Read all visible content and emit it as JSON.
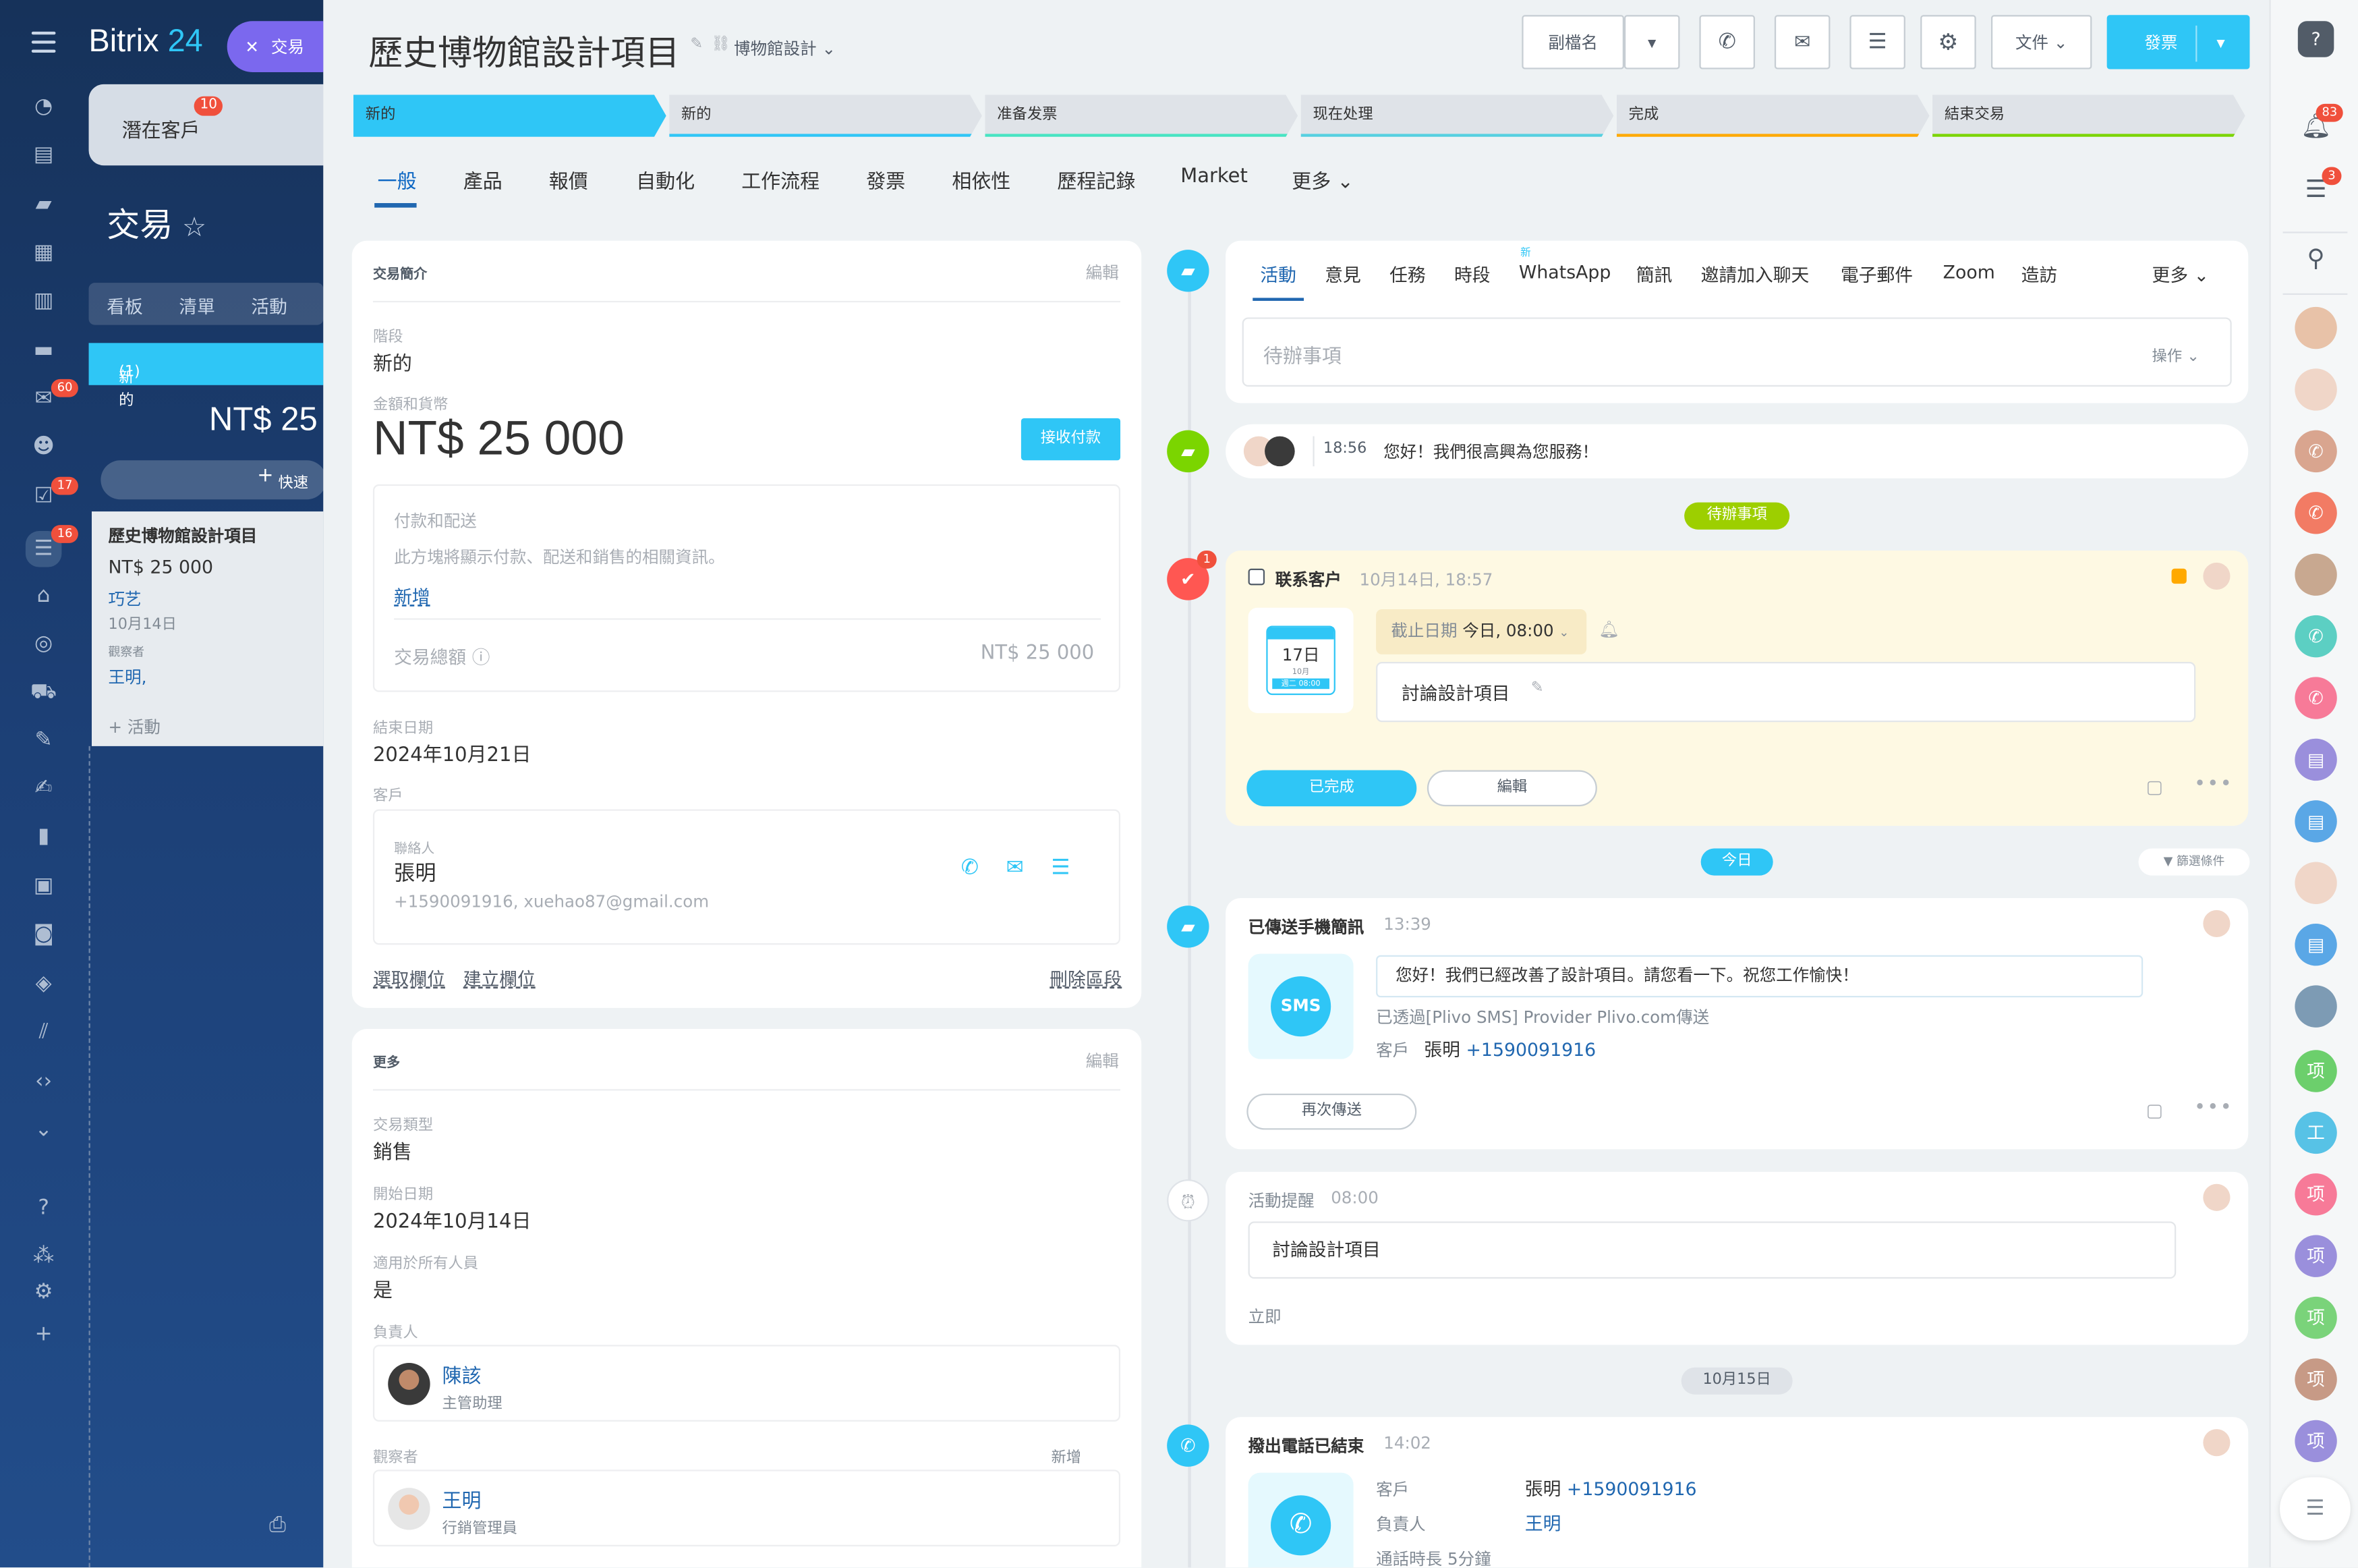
{
  "left_sidebar": {
    "brand_main": "Bitrix",
    "brand_num": "24",
    "chip_label": "交易",
    "badges": {
      "messages": "60",
      "tasks": "17",
      "crm": "16"
    }
  },
  "kanban": {
    "lead_label": "潛在客戶",
    "lead_badge": "10",
    "page_title": "交易",
    "tabs": [
      "看板",
      "清單",
      "活動"
    ],
    "column_name": "新的",
    "column_count": "(1)",
    "column_sum": "NT$ 25",
    "quick_label": "快速",
    "card": {
      "title": "歷史博物館設計項目",
      "value": "NT$ 25 000",
      "company": "巧艺",
      "date": "10月14日",
      "observer_label": "觀察者",
      "observer": "王明,",
      "activity": "+ 活動"
    }
  },
  "header": {
    "title": "歷史博物館設計項目",
    "category": "博物館設計",
    "rename_button": "副檔名",
    "document_button": "文件",
    "invoice_button": "發票"
  },
  "stages": [
    {
      "label": "新的",
      "color": "#2fc6f6"
    },
    {
      "label": "新的",
      "color": "#2fc6f6"
    },
    {
      "label": "准备发票",
      "color": "#47e4c2"
    },
    {
      "label": "现在处理",
      "color": "#55d0e0"
    },
    {
      "label": "完成",
      "color": "#ffa900"
    },
    {
      "label": "結束交易",
      "color": "#7bd500"
    }
  ],
  "tabs": [
    "一般",
    "產品",
    "報價",
    "自動化",
    "工作流程",
    "發票",
    "相依性",
    "歷程記錄",
    "Market",
    "更多"
  ],
  "summary": {
    "section_title": "交易簡介",
    "edit": "編輯",
    "stage_label": "階段",
    "stage_value": "新的",
    "amount_label": "金額和貨幣",
    "amount_value": "NT$ 25 000",
    "receive_payment": "接收付款",
    "payment_title": "付款和配送",
    "payment_desc": "此方塊將顯示付款、配送和銷售的相關資訊。",
    "payment_add": "新增",
    "total_label": "交易總額",
    "total_value": "NT$ 25 000",
    "close_date_label": "結束日期",
    "close_date_value": "2024年10月21日",
    "client_label": "客戶",
    "contact_label": "聯絡人",
    "contact_name": "張明",
    "contact_info": "+1590091916, xuehao87@gmail.com",
    "select_field": "選取欄位",
    "create_field": "建立欄位",
    "delete_section": "刪除區段"
  },
  "more": {
    "section_title": "更多",
    "edit": "編輯",
    "type_label": "交易類型",
    "type_value": "銷售",
    "start_label": "開始日期",
    "start_value": "2024年10月14日",
    "all_label": "適用於所有人員",
    "all_value": "是",
    "resp_label": "負責人",
    "resp_name": "陳該",
    "resp_role": "主管助理",
    "obs_label": "觀察者",
    "obs_add": "新增",
    "obs_name": "王明",
    "obs_role": "行銷管理員"
  },
  "timeline": {
    "tabs": [
      "活動",
      "意見",
      "任務",
      "時段",
      "WhatsApp",
      "簡訊",
      "邀請加入聊天",
      "電子郵件",
      "Zoom",
      "造訪",
      "更多"
    ],
    "new_tag": "新",
    "todo_placeholder": "待辦事項",
    "actions": "操作",
    "greeting_time": "18:56",
    "greeting_text": "您好！我們很高興為您服務！",
    "todo_pill": "待辦事項",
    "task": {
      "badge": "1",
      "title": "联系客户",
      "time": "10月14日, 18:57",
      "cal_day": "17日",
      "cal_month": "10月",
      "cal_time": "週二 08:00",
      "deadline_label": "截止日期",
      "deadline_value": "今日, 08:00",
      "text": "討論設計項目",
      "done_button": "已完成",
      "edit_button": "編輯"
    },
    "today_pill": "今日",
    "filter": "篩選條件",
    "sms": {
      "title": "已傳送手機簡訊",
      "time": "13:39",
      "icon_text": "SMS",
      "message": "您好！我們已經改善了設計項目。請您看一下。祝您工作愉快！",
      "via": "已透過[Plivo SMS] Provider Plivo.com傳送",
      "client_label": "客戶",
      "client_name": "張明",
      "client_phone": "+1590091916",
      "resend": "再次傳送"
    },
    "reminder": {
      "title": "活動提醒",
      "time": "08:00",
      "text": "討論設計項目",
      "when": "立即"
    },
    "date_pill": "10月15日",
    "call": {
      "title": "撥出電話已結束",
      "time": "14:02",
      "client_label": "客戶",
      "client_name": "張明",
      "client_phone": "+1590091916",
      "resp_label": "負責人",
      "resp_name": "王明",
      "duration": "通話時長 5分鐘"
    }
  },
  "right_sidebar": {
    "notif_badge": "83",
    "chat_badge": "3",
    "letters": [
      "项",
      "工",
      "项",
      "项",
      "项",
      "项",
      "项"
    ]
  }
}
